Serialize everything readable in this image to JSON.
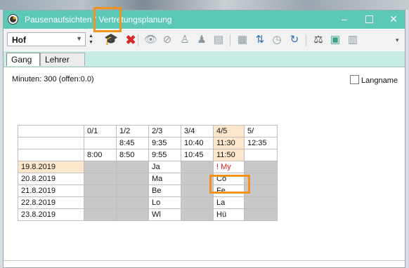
{
  "window": {
    "title": "Pausenaufsichten / Vertretungsplanung"
  },
  "toolbar": {
    "combo_value": "Hof",
    "icons": [
      "spinner-icon",
      "mortarboard-icon",
      "delete-x-icon",
      "eye-icon",
      "eye-crossed-icon",
      "teacher-icon",
      "teachers-icon",
      "signal-icon",
      "grid-icon",
      "transfer-icon",
      "clock-icon",
      "refresh-icon",
      "scale-icon",
      "image-icon",
      "book-icon"
    ]
  },
  "tabs": [
    {
      "label": "Gang"
    },
    {
      "label": "Lehrer"
    }
  ],
  "info": {
    "minutes": "Minuten: 300 (offen:0.0)"
  },
  "langname": {
    "label": "Langname"
  },
  "grid": {
    "header_periods": [
      "0/1",
      "1/2",
      "2/3",
      "3/4",
      "4/5",
      "5/"
    ],
    "header_start": [
      "",
      "8:45",
      "9:35",
      "10:40",
      "11:30",
      "12:35"
    ],
    "header_end": [
      "8:00",
      "8:50",
      "9:55",
      "10:45",
      "11:50",
      ""
    ],
    "rows": [
      {
        "date": "19.8.2019",
        "c3": "Ja",
        "c5": "! My"
      },
      {
        "date": "20.8.2019",
        "c3": "Ma",
        "c5": "Co"
      },
      {
        "date": "21.8.2019",
        "c3": "Be",
        "c5": "Fe"
      },
      {
        "date": "22.8.2019",
        "c3": "Lo",
        "c5": "La"
      },
      {
        "date": "23.8.2019",
        "c3": "Wl",
        "c5": "Hü"
      }
    ]
  }
}
